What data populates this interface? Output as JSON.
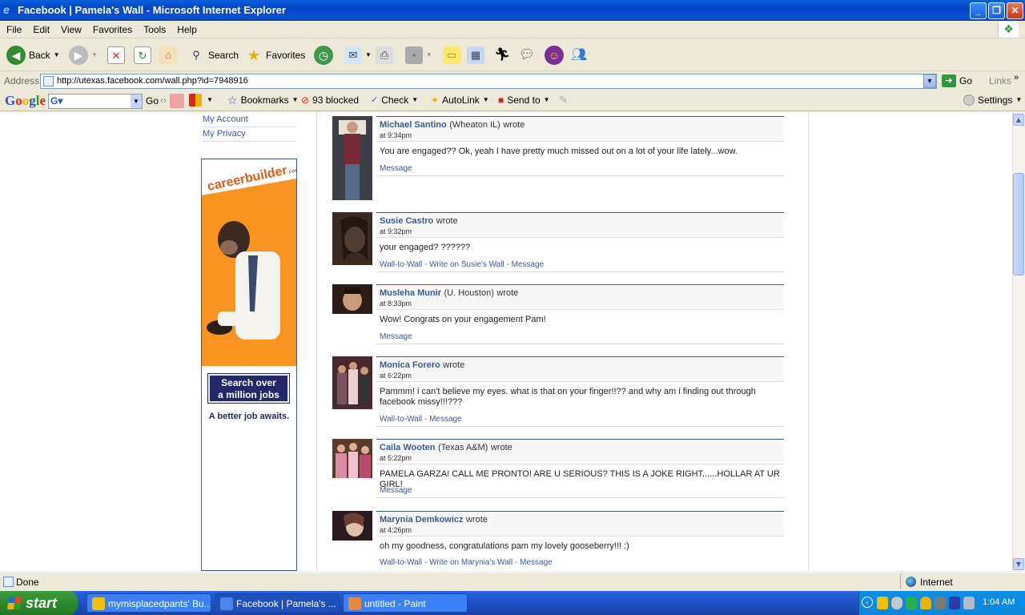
{
  "window": {
    "title": "Facebook | Pamela's Wall - Microsoft Internet Explorer"
  },
  "menu": [
    "File",
    "Edit",
    "View",
    "Favorites",
    "Tools",
    "Help"
  ],
  "toolbar": {
    "back": "Back",
    "search": "Search",
    "favorites": "Favorites"
  },
  "address": {
    "label": "Address",
    "url": "http://utexas.facebook.com/wall.php?id=7948916",
    "go": "Go",
    "links": "Links"
  },
  "googlebar": {
    "logo": "Google",
    "go": "Go",
    "bookmarks": "Bookmarks",
    "blocked": "93 blocked",
    "check": "Check",
    "autolink": "AutoLink",
    "sendto": "Send to",
    "settings": "Settings"
  },
  "sidebar": {
    "links": [
      "My Account",
      "My Privacy"
    ]
  },
  "ad": {
    "brand": "careerbuilder",
    "brand_suffix": ".com",
    "cta_line1": "Search over",
    "cta_line2": "a million jobs",
    "tagline": "A better job awaits."
  },
  "posts": [
    {
      "name": "Michael Santino",
      "network": "(Wheaton IL)",
      "wrote": "wrote",
      "time": "at 9:34pm",
      "body": "You are engaged?? Ok, yeah I have pretty much missed out on a lot of your life lately...wow.",
      "actions": [
        "Message"
      ]
    },
    {
      "name": "Susie Castro",
      "network": "",
      "wrote": "wrote",
      "time": "at 9:32pm",
      "body": "your engaged? ??????",
      "actions": [
        "Wall-to-Wall",
        "Write on Susie's Wall",
        "Message"
      ]
    },
    {
      "name": "Musleha Munir",
      "network": "(U. Houston)",
      "wrote": "wrote",
      "time": "at 8:33pm",
      "body": "Wow! Congrats on your engagement Pam!",
      "actions": [
        "Message"
      ]
    },
    {
      "name": "Monica Forero",
      "network": "",
      "wrote": "wrote",
      "time": "at 6:22pm",
      "body": "Pammm! i can't believe my eyes. what is that on your finger!!?? and why am i finding out through facebook missy!!!???",
      "actions": [
        "Wall-to-Wall",
        "Message"
      ]
    },
    {
      "name": "Caila Wooten",
      "network": "(Texas A&M)",
      "wrote": "wrote",
      "time": "at 5:22pm",
      "body": "PAMELA GARZA! CALL ME PRONTO! ARE U SERIOUS? THIS IS A JOKE RIGHT......HOLLAR AT UR GIRL!",
      "actions": [
        "Message"
      ]
    },
    {
      "name": "Marynia Demkowicz",
      "network": "",
      "wrote": "wrote",
      "time": "at 4:26pm",
      "body": "oh my goodness, congratulations pam my lovely gooseberry!!! :)",
      "actions": [
        "Wall-to-Wall",
        "Write on Marynia's Wall",
        "Message"
      ]
    }
  ],
  "status": {
    "text": "Done",
    "zone": "Internet"
  },
  "taskbar": {
    "start": "start",
    "tasks": [
      "mymisplacedpants' Bu...",
      "Facebook | Pamela's ...",
      "untitled - Paint"
    ],
    "clock": "1:04 AM"
  },
  "colors": {
    "fb_blue": "#3b5998",
    "xp_title": "#0a5fd8",
    "start_green": "#2d8a2d"
  }
}
